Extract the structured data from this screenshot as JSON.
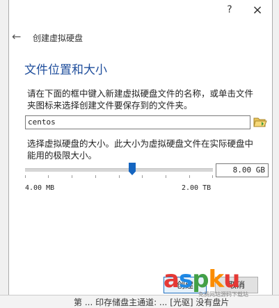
{
  "titlebar": {
    "help": "?",
    "close": "×"
  },
  "header": {
    "back": "←",
    "title": "创建虚拟硬盘"
  },
  "page_title": "文件位置和大小",
  "location_description": "请在下面的框中键入新建虚拟硬盘文件的名称，或单击文件夹图标来选择创建文件要保存到的文件夹。",
  "file_name": "centos",
  "size_description": "选择虚拟硬盘的大小。此大小为虚拟硬盘文件在实际硬盘中能用的极限大小。",
  "slider": {
    "value_fraction": 0.57
  },
  "size_value": "8.00 GB",
  "min_label": "4.00 MB",
  "max_label": "2.00 TB",
  "buttons": {
    "create": "创建",
    "cancel": "取消"
  },
  "background_text": "第 ... 印存储盘主通道: ... [光驱] 没有盘片",
  "watermark": {
    "logo": "aspku",
    "sub": "免费网站源码下载站",
    "colors": {
      "a": "#e53935",
      "s": "#1e88e5",
      "p": "#43a047",
      "k": "#fb8c00",
      "u": "#e53935"
    }
  },
  "colors": {
    "title_blue": "#1f4e9c",
    "slider_thumb": "#1565c0",
    "folder_icon": "folder-open-icon"
  }
}
